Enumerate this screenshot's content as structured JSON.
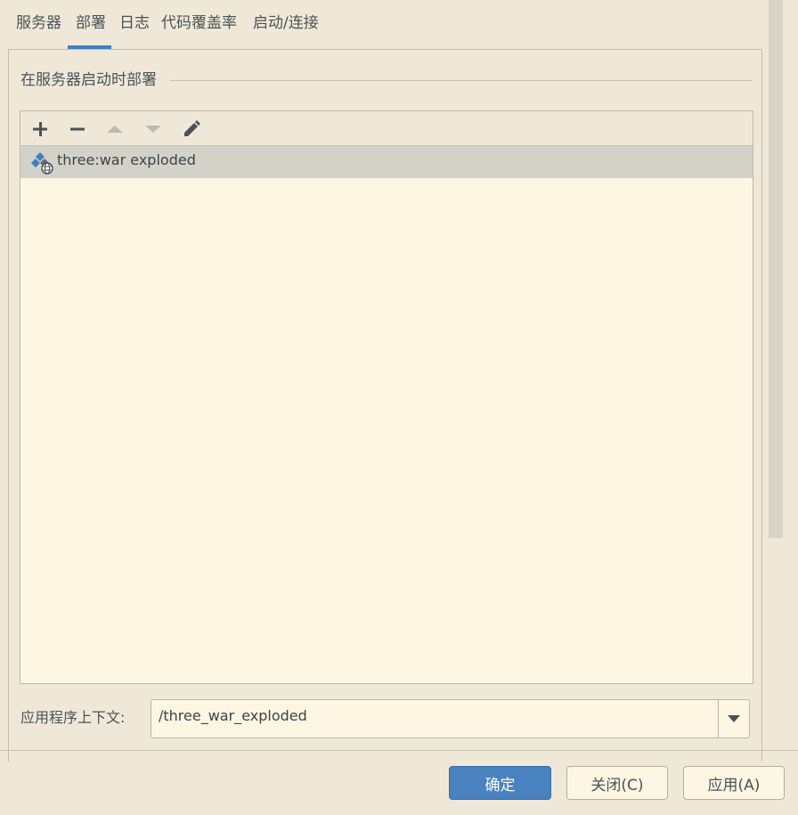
{
  "tabs": [
    {
      "label": "服务器"
    },
    {
      "label": "部署"
    },
    {
      "label": "日志"
    },
    {
      "label": "代码覆盖率"
    },
    {
      "label": "启动/连接"
    }
  ],
  "active_tab": "部署",
  "deploy_group": {
    "title": "在服务器启动时部署",
    "toolbar": [
      "add-icon",
      "remove-icon",
      "move-up-icon",
      "move-down-icon",
      "edit-icon"
    ],
    "items": [
      {
        "label": "three:war exploded",
        "icon": "artifact-web-icon",
        "selected": true
      }
    ]
  },
  "context": {
    "label": "应用程序上下文:",
    "value": "/three_war_exploded"
  },
  "buttons": {
    "ok": "确定",
    "close": "关闭(C)",
    "apply": "应用(A)"
  },
  "colors": {
    "accent": "#3f7fc0",
    "background": "#efe8d8",
    "list_background": "#fdf6e3",
    "selection": "#d3d2c8"
  }
}
